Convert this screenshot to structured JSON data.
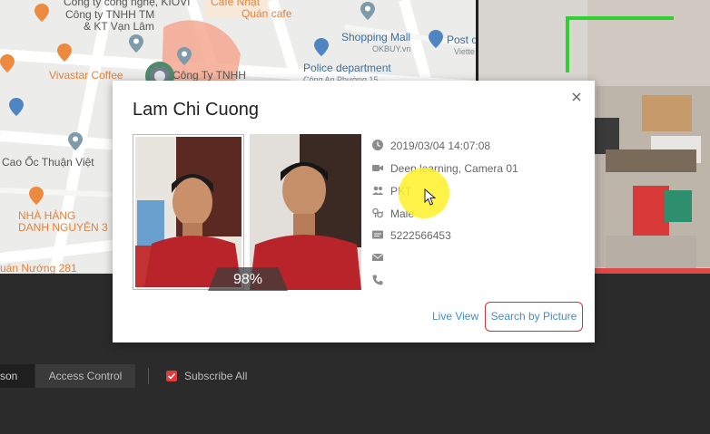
{
  "map": {
    "labels": {
      "cong_nghe": "Công ty công nghệ, KIOVI",
      "cafe_nhat": "Café Nhật",
      "cong_ty_tm": "Công ty TNHH TM",
      "kt_van_lam": "& KT Vạn Lâm",
      "quan_cafe": "Quán cafe",
      "shopping_mall": "Shopping Mall",
      "okbuy": "OKBUY.vn",
      "post_office": "Post o",
      "viettel": "Viette",
      "vivastar": "Vivastar Coffee",
      "cong_ty_tnhh": "Công Ty TNHH",
      "police": "Police department",
      "cong_an": "Công An Phường 15",
      "cao_oc": "Cao Ốc Thuận Việt",
      "nha_hang": "NHÀ HÀNG",
      "danh_nguyen": "DANH NGUYÊN 3",
      "quan_nuong": "uán Nướng 281"
    }
  },
  "bottom": {
    "tabs": {
      "person": "son",
      "access_control": "Access Control"
    },
    "subscribe_label": "Subscribe All"
  },
  "dialog": {
    "title": "Lam Chi Cuong",
    "similarity": "98%",
    "info": {
      "datetime": "2019/03/04 14:07:08",
      "source": "Deep learning, Camera 01",
      "group": "PKT",
      "gender": "Male",
      "id_number": "5222566453",
      "email": "",
      "phone": ""
    },
    "live_view_label": "Live View",
    "search_by_picture_label": "Search by Picture"
  },
  "colors": {
    "accent_link": "#3b8fd4",
    "highlight_red": "#d63030",
    "map_poi_orange": "#e3813a",
    "map_poi_blue": "#3d6f9e",
    "camera_overlay_green": "#2fd02f"
  },
  "icons": {
    "close": "close-icon",
    "clock": "clock-icon",
    "camera": "video-camera-icon",
    "group": "people-group-icon",
    "gender": "gender-icon",
    "id_card": "id-card-icon",
    "email": "envelope-icon",
    "phone": "phone-icon"
  }
}
